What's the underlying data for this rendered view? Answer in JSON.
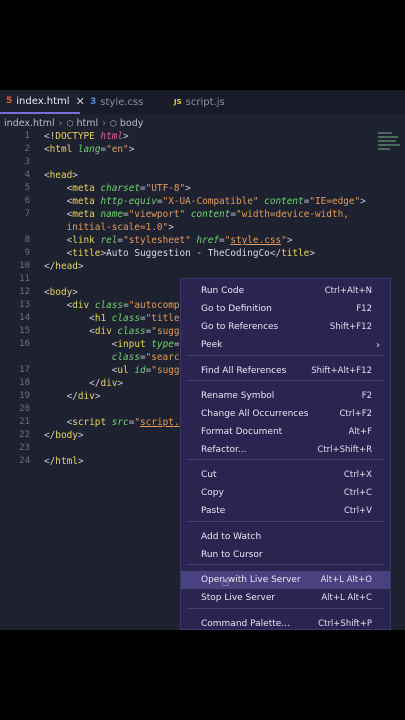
{
  "tabs": [
    {
      "icon": "5",
      "label": "index.html",
      "close": "✕"
    },
    {
      "icon": "3",
      "label": "style.css"
    },
    {
      "icon": "JS",
      "label": "script.js"
    }
  ],
  "breadcrumb": [
    "index.html",
    "html",
    "body"
  ],
  "line_numbers": [
    "1",
    "2",
    "3",
    "4",
    "5",
    "6",
    "7",
    "",
    "8",
    "9",
    "10",
    "11",
    "12",
    "13",
    "14",
    "15",
    "16",
    "",
    "17",
    "18",
    "19",
    "20",
    "21",
    "22",
    "23",
    "24"
  ],
  "menu": {
    "items": [
      {
        "label": "Run Code",
        "shortcut": "Ctrl+Alt+N"
      },
      {
        "label": "Go to Definition",
        "shortcut": "F12"
      },
      {
        "label": "Go to References",
        "shortcut": "Shift+F12"
      },
      {
        "label": "Peek",
        "shortcut": "›"
      },
      {
        "label": "Find All References",
        "shortcut": "Shift+Alt+F12"
      },
      {
        "label": "Rename Symbol",
        "shortcut": "F2"
      },
      {
        "label": "Change All Occurrences",
        "shortcut": "Ctrl+F2"
      },
      {
        "label": "Format Document",
        "shortcut": "Alt+F"
      },
      {
        "label": "Refactor...",
        "shortcut": "Ctrl+Shift+R"
      },
      {
        "label": "Cut",
        "shortcut": "Ctrl+X"
      },
      {
        "label": "Copy",
        "shortcut": "Ctrl+C"
      },
      {
        "label": "Paste",
        "shortcut": "Ctrl+V"
      },
      {
        "label": "Add to Watch",
        "shortcut": ""
      },
      {
        "label": "Run to Cursor",
        "shortcut": ""
      },
      {
        "label": "Open with Live Server",
        "shortcut": "Alt+L Alt+O"
      },
      {
        "label": "Stop Live Server",
        "shortcut": "Alt+L Alt+C"
      },
      {
        "label": "Command Palette...",
        "shortcut": "Ctrl+Shift+P"
      }
    ]
  },
  "colors": {
    "editor_bg": "#1e2230",
    "menu_bg": "#2b2450",
    "accent": "#7d6bd8"
  }
}
